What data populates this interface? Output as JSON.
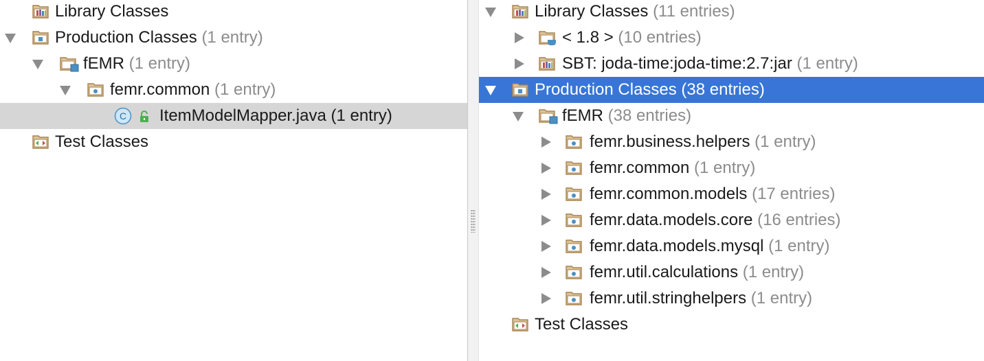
{
  "left": {
    "rows": [
      {
        "label": "Library Classes",
        "count": ""
      },
      {
        "label": "Production Classes",
        "count": "(1 entry)"
      },
      {
        "label": "fEMR",
        "count": "(1 entry)"
      },
      {
        "label": "femr.common",
        "count": "(1 entry)"
      },
      {
        "label": "ItemModelMapper.java (1 entry)",
        "count": ""
      },
      {
        "label": "Test Classes",
        "count": ""
      }
    ]
  },
  "right": {
    "rows": [
      {
        "label": "Library Classes",
        "count": "(11 entries)"
      },
      {
        "label": "< 1.8 >",
        "count": "(10 entries)"
      },
      {
        "label": "SBT: joda-time:joda-time:2.7:jar",
        "count": "(1 entry)"
      },
      {
        "label": "Production Classes (38 entries)",
        "count": ""
      },
      {
        "label": "fEMR",
        "count": "(38 entries)"
      },
      {
        "label": "femr.business.helpers",
        "count": "(1 entry)"
      },
      {
        "label": "femr.common",
        "count": "(1 entry)"
      },
      {
        "label": "femr.common.models",
        "count": "(17 entries)"
      },
      {
        "label": "femr.data.models.core",
        "count": "(16 entries)"
      },
      {
        "label": "femr.data.models.mysql",
        "count": "(1 entry)"
      },
      {
        "label": "femr.util.calculations",
        "count": "(1 entry)"
      },
      {
        "label": "femr.util.stringhelpers",
        "count": "(1 entry)"
      },
      {
        "label": "Test Classes",
        "count": ""
      }
    ]
  },
  "class_icon_letter": "C",
  "colors": {
    "selection_blue": "#3875d7",
    "selection_gray": "#d6d6d6",
    "folder_brown": "#b8925a",
    "muted_text": "#8c8c8c"
  },
  "icons": {
    "library": "library-folder-icon",
    "production": "source-folder-icon",
    "module": "module-folder-icon",
    "package": "package-folder-icon",
    "jdk": "jdk-folder-icon",
    "test": "test-folder-icon",
    "class": "class-icon",
    "lock": "lock-icon",
    "arrow_down": "expand-arrow-icon",
    "arrow_right": "collapse-arrow-icon"
  }
}
